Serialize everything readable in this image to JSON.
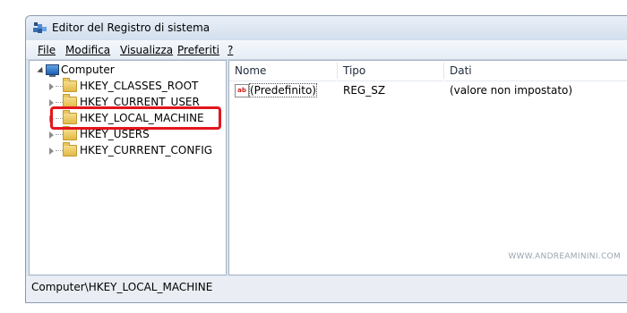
{
  "window": {
    "title": "Editor del Registro di sistema"
  },
  "menu": [
    {
      "label": "File",
      "accel_index": 0
    },
    {
      "label": "Modifica",
      "accel_index": 0
    },
    {
      "label": "Visualizza",
      "accel_index": 0
    },
    {
      "label": "Preferiti",
      "accel_index": 0
    },
    {
      "label": "?",
      "accel_index": 0
    }
  ],
  "tree": {
    "root": "Computer",
    "keys": [
      {
        "label": "HKEY_CLASSES_ROOT",
        "selected": false
      },
      {
        "label": "HKEY_CURRENT_USER",
        "selected": false
      },
      {
        "label": "HKEY_LOCAL_MACHINE",
        "selected": true
      },
      {
        "label": "HKEY_USERS",
        "selected": false
      },
      {
        "label": "HKEY_CURRENT_CONFIG",
        "selected": false
      }
    ]
  },
  "list": {
    "columns": [
      "Nome",
      "Tipo",
      "Dati"
    ],
    "rows": [
      {
        "name": "(Predefinito)",
        "type": "REG_SZ",
        "data": "(valore non impostato)"
      }
    ]
  },
  "status": {
    "path": "Computer\\HKEY_LOCAL_MACHINE"
  },
  "watermark": "WWW.ANDREAMININI.COM",
  "colors": {
    "highlight": "#e4151d",
    "titlebar": "#d3dfee",
    "folder": "#e2b947"
  }
}
